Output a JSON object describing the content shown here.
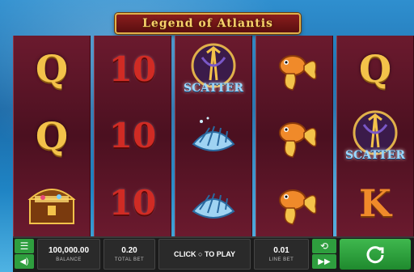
{
  "game": {
    "title": "Legend of Atlantis"
  },
  "reels": [
    [
      "Q",
      "Q",
      "chest"
    ],
    [
      "10",
      "10",
      "10"
    ],
    [
      "scatter",
      "shell",
      "shell"
    ],
    [
      "goldfish",
      "goldfish",
      "goldfish"
    ],
    [
      "Q",
      "scatter",
      "K"
    ]
  ],
  "symbols": {
    "scatter_label": "SCATTER"
  },
  "controls": {
    "balance": {
      "value": "100,000.00",
      "label": "BALANCE"
    },
    "total_bet": {
      "value": "0.20",
      "label": "TOTAL BET"
    },
    "play": {
      "text": "CLICK ○ TO PLAY"
    },
    "line_bet": {
      "value": "0.01",
      "label": "LINE BET"
    },
    "menu_icon": "hamburger-icon",
    "sound_icon": "speaker-icon",
    "auto_icon": "autoplay-icon",
    "turbo_icon": "fast-forward-icon",
    "spin_icon": "spin-icon"
  },
  "colors": {
    "accent": "#2e9e3e",
    "reel_bg": "#4b1020",
    "gold": "#f3c24a",
    "red": "#d02b24"
  }
}
